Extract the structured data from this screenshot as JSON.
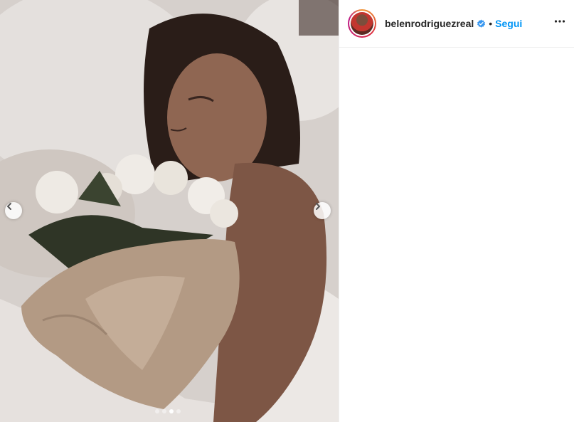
{
  "post": {
    "username": "belenrodriguezreal",
    "separator": "•",
    "follow_label": "Segui",
    "verified": true,
    "carousel": {
      "total": 4,
      "active_index": 2
    }
  },
  "icons": {
    "verified": "verified-badge-icon",
    "more": "more-options-icon",
    "prev": "chevron-left-icon",
    "next": "chevron-right-icon"
  },
  "colors": {
    "link_blue": "#0095f6",
    "verified_blue": "#3897f0",
    "text": "#262626"
  }
}
